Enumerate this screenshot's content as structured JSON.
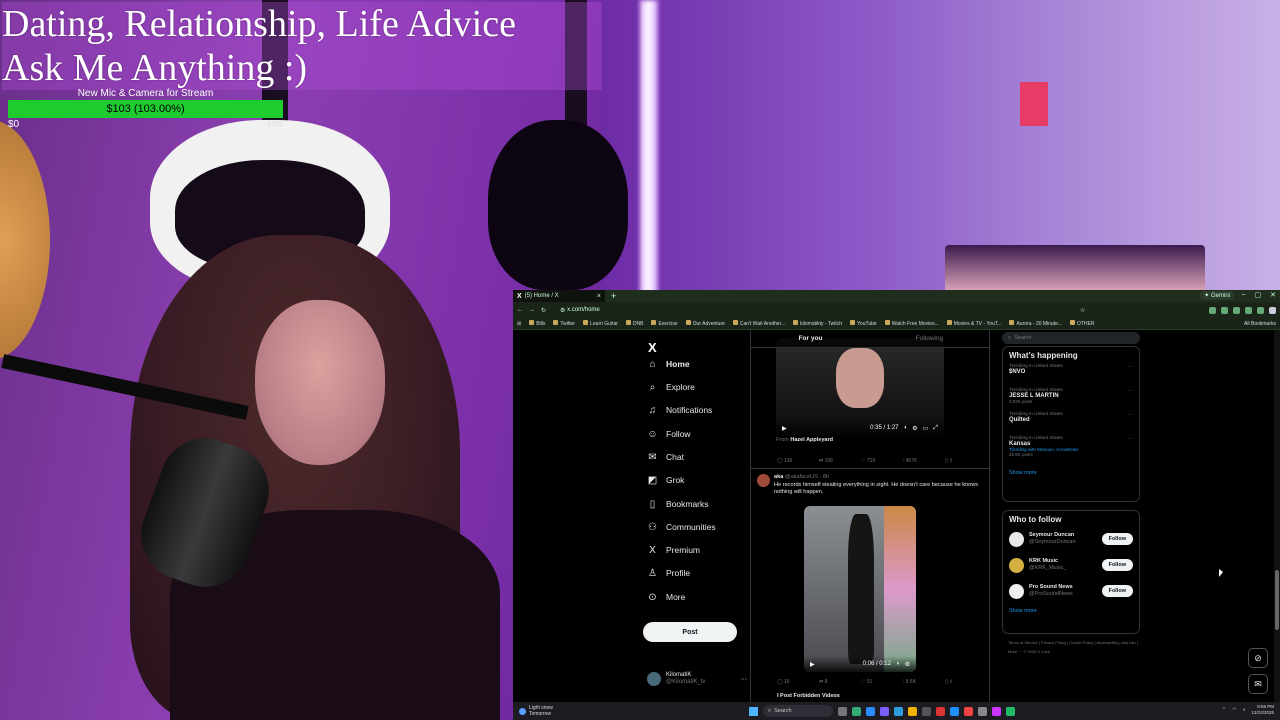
{
  "stream": {
    "title_line1": "Dating, Relationship, Life Advice",
    "title_line2": "Ask Me Anything :)",
    "goal_label": "New Mic & Camera for Stream",
    "goal_text": "$103 (103.00%)",
    "goal_progress": 1.0,
    "goal_min": "$0",
    "goal_max": "$100"
  },
  "browser": {
    "tab_title": "(5) Home / X",
    "gemini_label": "Gemini",
    "url": "x.com/home",
    "bookmarks": [
      "Bills",
      "Twitter",
      "Learn Guitar",
      "DNB",
      "Exercise",
      "Our Adventure",
      "Can't Wait Another...",
      "kilomatikty - Twitch",
      "YouTube",
      "Watch Free Movies...",
      "Movies & TV - YouT...",
      "Aurora - 30 Minute...",
      "OTHER"
    ],
    "all_bookmarks": "All Bookmarks"
  },
  "x": {
    "nav": [
      {
        "label": "Home",
        "icon": "home-icon",
        "glyph": "⌂"
      },
      {
        "label": "Explore",
        "icon": "search-icon",
        "glyph": "⌕"
      },
      {
        "label": "Notifications",
        "icon": "bell-icon",
        "glyph": "♫"
      },
      {
        "label": "Follow",
        "icon": "follow-icon",
        "glyph": "☺"
      },
      {
        "label": "Chat",
        "icon": "chat-icon",
        "glyph": "✉"
      },
      {
        "label": "Grok",
        "icon": "grok-icon",
        "glyph": "◩"
      },
      {
        "label": "Bookmarks",
        "icon": "bookmark-icon",
        "glyph": "▯"
      },
      {
        "label": "Communities",
        "icon": "communities-icon",
        "glyph": "⚇"
      },
      {
        "label": "Premium",
        "icon": "x-icon",
        "glyph": "X"
      },
      {
        "label": "Profile",
        "icon": "profile-icon",
        "glyph": "♙"
      },
      {
        "label": "More",
        "icon": "more-icon",
        "glyph": "⊙"
      }
    ],
    "post_label": "Post",
    "account": {
      "name": "KilomatiK",
      "handle": "@KilomatiK_tv"
    },
    "tabs": {
      "for_you": "For you",
      "following": "Following"
    },
    "tweet1": {
      "video_time": "0:35 / 1:27",
      "from_prefix": "From",
      "from_name": "Hazel Appleyard",
      "replies": "136",
      "reposts": "156",
      "likes": "719",
      "views": "457K"
    },
    "tweet2": {
      "name": "aka",
      "handle": "@akafaceUS · 8h",
      "text": "He records himself stealing everything in sight. He doesn't care because he knows nothing will happen.",
      "video_time": "0:06 / 0:12",
      "replies": "16",
      "reposts": "8",
      "likes": "51",
      "views": "9.5K"
    },
    "next_tweet": "I Post Forbidden Videos",
    "search_placeholder": "Search",
    "whats_happening": "What’s happening",
    "trends": [
      {
        "context": "Trending in United States",
        "name": "$NVO",
        "count": ""
      },
      {
        "context": "Trending in United States",
        "name": "JESSE L MARTIN",
        "count": "3,930 posts"
      },
      {
        "context": "Trending in United States",
        "name": "Quilted",
        "count": ""
      },
      {
        "context": "Trending in United States",
        "name": "Kansas",
        "count": "25.6K posts",
        "with": "Trending with Missouri, Arrowhead"
      }
    ],
    "show_more": "Show more",
    "who_to_follow": "Who to follow",
    "suggestions": [
      {
        "name": "Seymour Duncan",
        "handle": "@SeymourDuncan",
        "color": "#e8e8e8"
      },
      {
        "name": "KRK Music",
        "handle": "@KRK_Music_",
        "color": "#d4b040"
      },
      {
        "name": "Pro Sound News",
        "handle": "@ProSoundNews",
        "color": "#f0f0f0"
      }
    ],
    "follow_label": "Follow",
    "footer": "Terms of Service | Privacy Policy | Cookie Policy | Accessibility | Ads info | More ··· © 2025 X Corp."
  },
  "taskbar": {
    "weather_line1": "Light snow",
    "weather_line2": "Tomorrow",
    "search_label": "Search",
    "time": "8:55 PM",
    "date": "12/22/2025"
  }
}
